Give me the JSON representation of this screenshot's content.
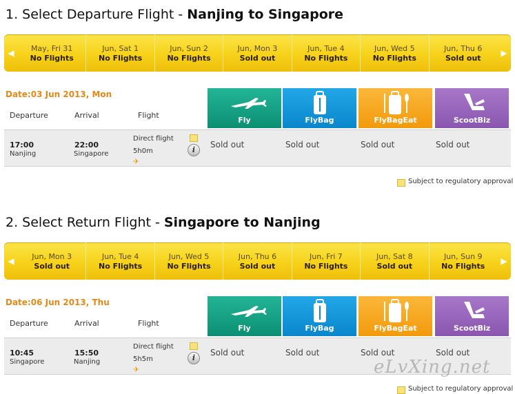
{
  "departure": {
    "step_label": "1. Select Departure Flight -",
    "route": "Nanjing  to  Singapore",
    "days": [
      {
        "date": "May, Fri 31",
        "status": "No Flights"
      },
      {
        "date": "Jun, Sat 1",
        "status": "No Flights"
      },
      {
        "date": "Jun, Sun 2",
        "status": "No Flights"
      },
      {
        "date": "Jun, Mon 3",
        "status": "Sold out"
      },
      {
        "date": "Jun, Tue 4",
        "status": "No Flights"
      },
      {
        "date": "Jun, Wed 5",
        "status": "No Flights"
      },
      {
        "date": "Jun, Thu 6",
        "status": "Sold out"
      }
    ],
    "flight_date": "Date:03 Jun 2013, Mon",
    "flight": {
      "dep_time": "17:00",
      "dep_city": "Nanjing",
      "arr_time": "22:00",
      "arr_city": "Singapore",
      "type": "Direct flight",
      "duration": "5h0m",
      "fares": [
        "Sold out",
        "Sold out",
        "Sold out",
        "Sold out"
      ]
    }
  },
  "return": {
    "step_label": "2. Select Return Flight -",
    "route": "Singapore  to  Nanjing",
    "days": [
      {
        "date": "Jun, Mon 3",
        "status": "Sold out"
      },
      {
        "date": "Jun, Tue 4",
        "status": "No Flights"
      },
      {
        "date": "Jun, Wed 5",
        "status": "No Flights"
      },
      {
        "date": "Jun, Thu 6",
        "status": "Sold out"
      },
      {
        "date": "Jun, Fri 7",
        "status": "No Flights"
      },
      {
        "date": "Jun, Sat 8",
        "status": "Sold out"
      },
      {
        "date": "Jun, Sun 9",
        "status": "No Flights"
      }
    ],
    "flight_date": "Date:06 Jun 2013, Thu",
    "flight": {
      "dep_time": "10:45",
      "dep_city": "Singapore",
      "arr_time": "15:50",
      "arr_city": "Nanjing",
      "type": "Direct flight",
      "duration": "5h5m",
      "fares": [
        "Sold out",
        "Sold out",
        "Sold out",
        "Sold out"
      ]
    }
  },
  "columns": {
    "departure": "Departure",
    "arrival": "Arrival",
    "flight": "Flight"
  },
  "fare_types": [
    "Fly",
    "FlyBag",
    "FlyBagEat",
    "ScootBiz"
  ],
  "regulatory_note": "Subject to regulatory approval",
  "watermark": "eLvXing.net",
  "colors": {
    "accent_orange": "#e28a19",
    "datebar_yellow": "#f7d21a",
    "fly": "#0c8f73",
    "flybag": "#0a86cc",
    "flybageat": "#f29a0c",
    "scootbiz": "#8a56b0"
  }
}
